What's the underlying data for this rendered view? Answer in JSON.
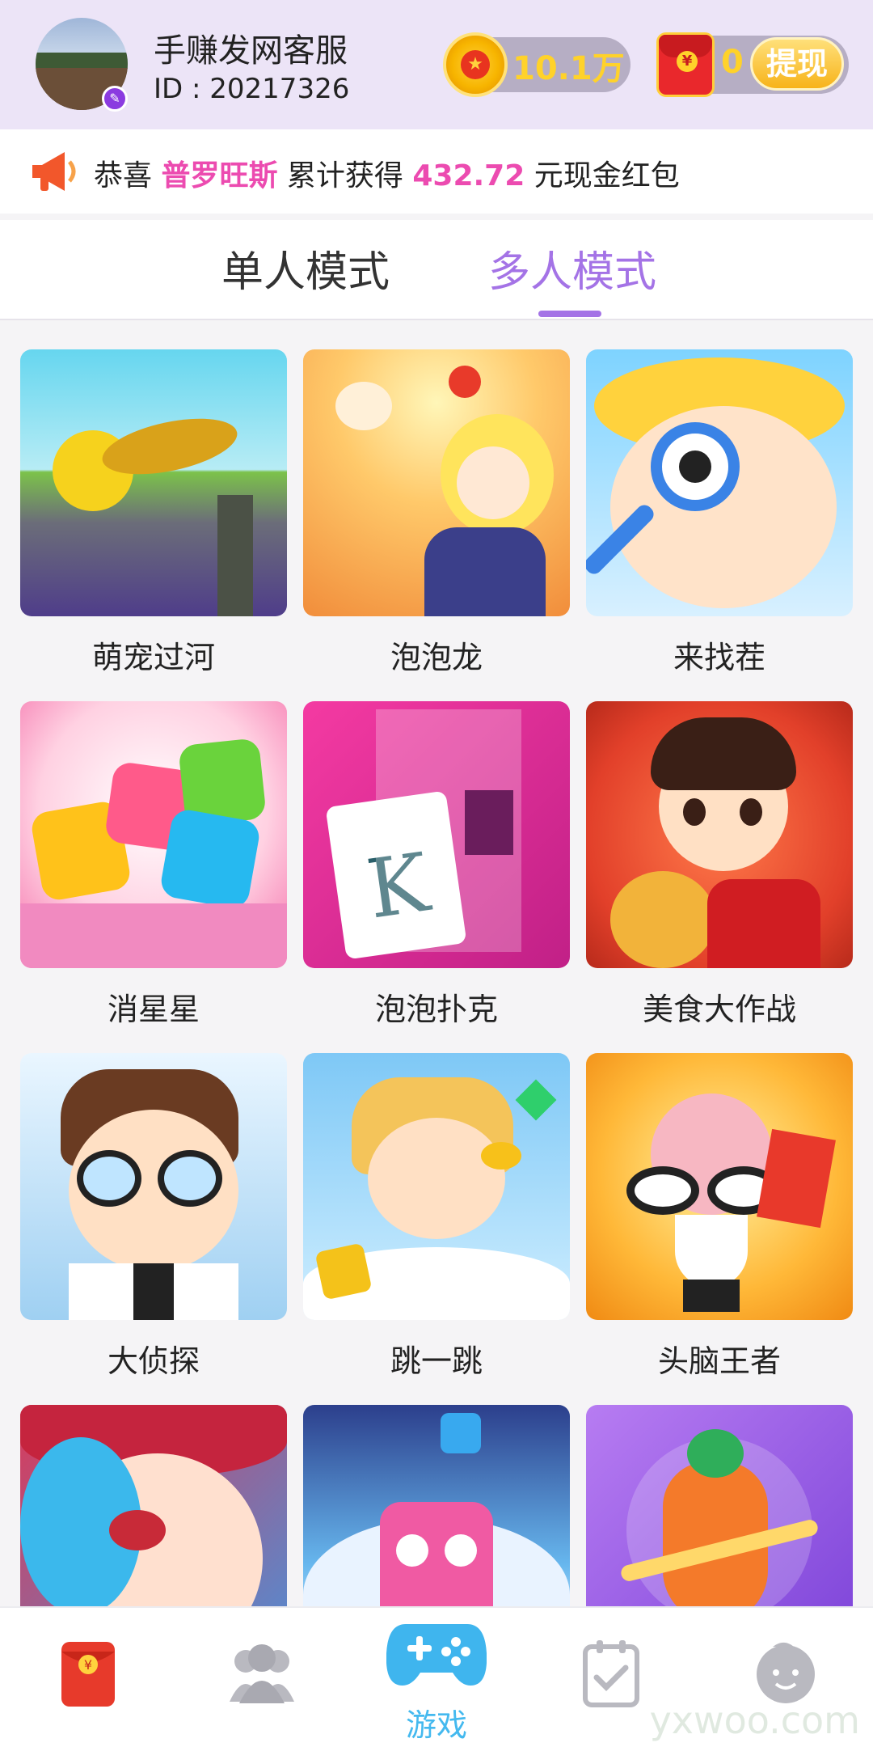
{
  "header": {
    "user_name": "手赚发网客服",
    "user_id": "ID : 20217326",
    "coins": "10.1万",
    "red_packets": "0",
    "withdraw_label": "提现"
  },
  "notice": {
    "prefix": "恭喜 ",
    "name": "普罗旺斯",
    "middle": " 累计获得 ",
    "amount": "432.72",
    "suffix": " 元现金红包"
  },
  "tabs": [
    {
      "label": "单人模式",
      "active": false
    },
    {
      "label": "多人模式",
      "active": true
    }
  ],
  "games": [
    {
      "title": "萌宠过河"
    },
    {
      "title": "泡泡龙"
    },
    {
      "title": "来找茬"
    },
    {
      "title": "消星星"
    },
    {
      "title": "泡泡扑克"
    },
    {
      "title": "美食大作战"
    },
    {
      "title": "大侦探"
    },
    {
      "title": "跳一跳"
    },
    {
      "title": "头脑王者"
    },
    {
      "title": ""
    },
    {
      "title": ""
    },
    {
      "title": ""
    }
  ],
  "bottom_nav": {
    "game_label": "游戏"
  },
  "watermark": "yxwoo.com",
  "colors": {
    "accent": "#a473e6",
    "highlight": "#ec4bb0",
    "nav_active": "#44b9ef"
  }
}
